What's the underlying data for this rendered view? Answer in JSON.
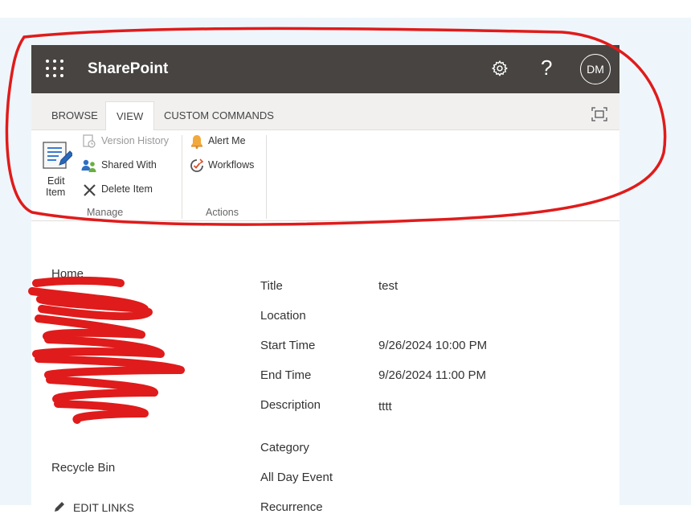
{
  "header": {
    "brand": "SharePoint",
    "help": "?",
    "avatar": "DM"
  },
  "ribbon": {
    "tabs": [
      {
        "label": "BROWSE"
      },
      {
        "label": "VIEW"
      },
      {
        "label": "CUSTOM COMMANDS"
      }
    ],
    "active_tab": "VIEW",
    "manage": {
      "edit_item_line1": "Edit",
      "edit_item_line2": "Item",
      "version_history": "Version History",
      "shared_with": "Shared With",
      "delete_item": "Delete Item",
      "group_label": "Manage"
    },
    "actions": {
      "alert_me": "Alert Me",
      "workflows": "Workflows",
      "group_label": "Actions"
    }
  },
  "leftnav": {
    "home": "Home",
    "recycle_bin": "Recycle Bin",
    "edit_links": "EDIT LINKS"
  },
  "fields": [
    {
      "label": "Title",
      "value": "test"
    },
    {
      "label": "Location",
      "value": ""
    },
    {
      "label": "Start Time",
      "value": "9/26/2024 10:00 PM"
    },
    {
      "label": "End Time",
      "value": "9/26/2024 11:00 PM"
    },
    {
      "label": "Description",
      "value": "tttt"
    },
    {
      "label": "Category",
      "value": ""
    },
    {
      "label": "All Day Event",
      "value": ""
    },
    {
      "label": "Recurrence",
      "value": ""
    }
  ],
  "colors": {
    "suite_bar": "#474441",
    "annotation_red": "#e01b1b"
  }
}
